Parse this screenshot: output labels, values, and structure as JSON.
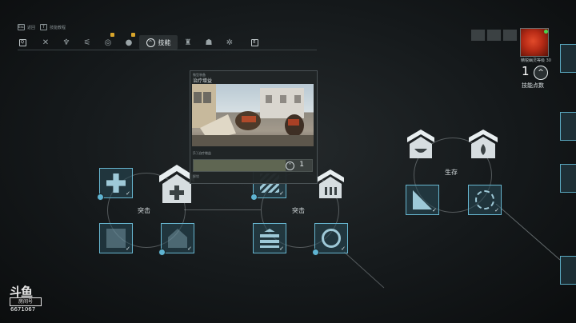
{
  "hints": {
    "key1": "Esc",
    "label1": "返回",
    "key2": "T",
    "label2": "技能教程"
  },
  "tabs": {
    "left_key": "Q",
    "right_key": "E",
    "active_label": "技能",
    "items": [
      "crossed-weapons-icon",
      "loadout-icon",
      "attachment-icon",
      "target-icon",
      "grenade-icon",
      "skills-icon",
      "shirt-icon",
      "helmet-icon",
      "gear-icon"
    ]
  },
  "player": {
    "level_text": "精锐幽灵等级 30",
    "skill_points": "1",
    "skill_points_label": "技能点数"
  },
  "popup": {
    "small_label": "微型装备",
    "title": "治疗增益",
    "row_text": "[1]  治疗增益",
    "cost": "1",
    "foot_text": "解锁",
    "progress": 0.78
  },
  "classes": [
    {
      "name": "突击"
    },
    {
      "name": "突击"
    },
    {
      "name": "生存"
    }
  ],
  "watermark": {
    "logo": "斗鱼",
    "box": "房间号",
    "room": "6671067"
  },
  "colors": {
    "accent": "#67b6d0",
    "badge": "#d8a52b",
    "online": "#4ad34e"
  }
}
